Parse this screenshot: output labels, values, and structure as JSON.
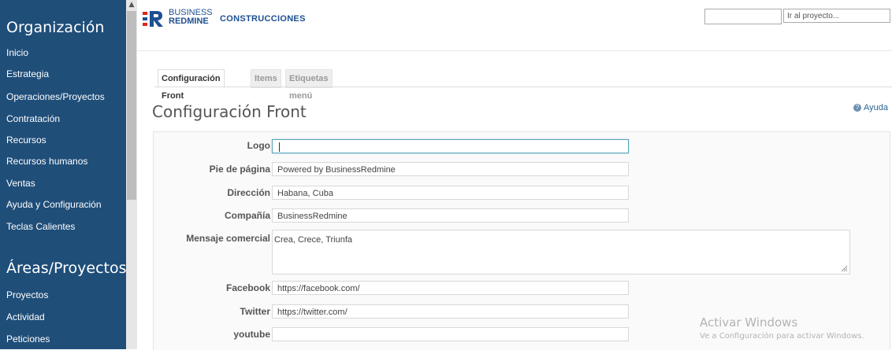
{
  "sidebar": {
    "section1_title": "Organización",
    "section1_items": [
      "Inicio",
      "Estrategia",
      "Operaciones/Proyectos",
      "Contratación",
      "Recursos",
      "Recursos humanos",
      "Ventas",
      "Ayuda y Configuración",
      "Teclas Calientes"
    ],
    "section2_title": "Áreas/Proyectos",
    "section2_items": [
      "Proyectos",
      "Actividad",
      "Peticiones"
    ]
  },
  "header": {
    "brand_line1": "BUSINESS",
    "brand_line2": "REDMINE",
    "org_name": "CONSTRUCCIONES",
    "search_value": "",
    "project_jump_placeholder": "Ir al proyecto..."
  },
  "tabs": [
    "Configuración Front",
    "Items",
    "Etiquetas menú"
  ],
  "page": {
    "title": "Configuración Front",
    "help_label": "Ayuda"
  },
  "form": {
    "logo_label": "Logo",
    "logo_value": "",
    "footer_label": "Pie de página",
    "footer_value": "Powered by BusinessRedmine",
    "address_label": "Dirección",
    "address_value": "Habana, Cuba",
    "company_label": "Compañía",
    "company_value": "BusinessRedmine",
    "message_label": "Mensaje comercial",
    "message_value": "Crea, Crece, Triunfa",
    "facebook_label": "Facebook",
    "facebook_value": "https://facebook.com/",
    "twitter_label": "Twitter",
    "twitter_value": "https://twitter.com/",
    "youtube_label": "youtube",
    "youtube_value": ""
  },
  "watermark": {
    "title": "Activar Windows",
    "subtitle": "Ve a Configuración para activar Windows."
  },
  "colors": {
    "sidebar_bg": "#1f4e79",
    "brand_blue": "#1d4f91",
    "logo_red": "#e2231a"
  }
}
